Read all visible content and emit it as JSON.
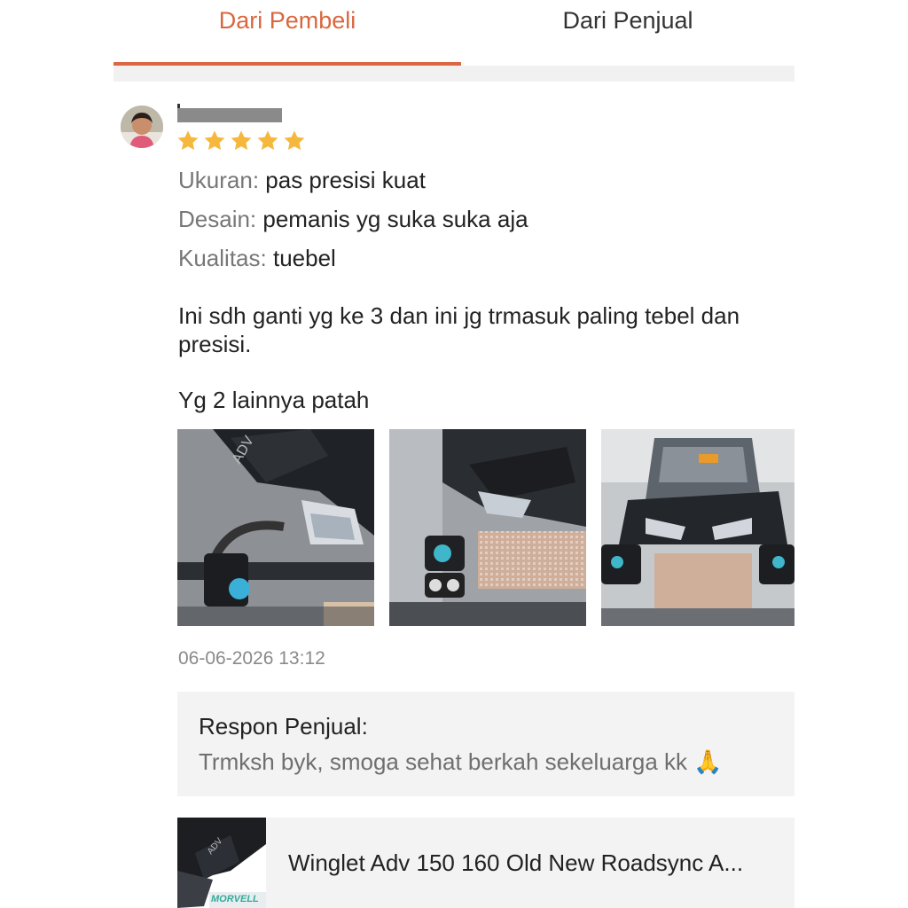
{
  "tabs": [
    {
      "label": "Dari Pembeli",
      "active": true
    },
    {
      "label": "Dari Penjual",
      "active": false
    }
  ],
  "review": {
    "rating": 5,
    "attributes": [
      {
        "key": "Ukuran:",
        "value": "pas presisi kuat"
      },
      {
        "key": "Desain:",
        "value": "pemanis yg suka suka aja"
      },
      {
        "key": "Kualitas:",
        "value": "tuebel"
      }
    ],
    "text_line1": "Ini sdh ganti yg ke 3 dan ini jg trmasuk paling tebel dan presisi.",
    "text_line2": "Yg 2 lainnya patah",
    "date": "06-06-2026 13:12"
  },
  "seller_response": {
    "title": "Respon Penjual:",
    "text": "Trmksh byk, smoga sehat berkah sekeluarga kk 🙏"
  },
  "product": {
    "name": "Winglet Adv 150 160 Old New Roadsync A...",
    "brand_logo_text": "MORVELL"
  },
  "colors": {
    "accent": "#d9673f",
    "star": "#f5b83d",
    "muted": "#8a8a8a",
    "panel": "#f3f3f3"
  }
}
